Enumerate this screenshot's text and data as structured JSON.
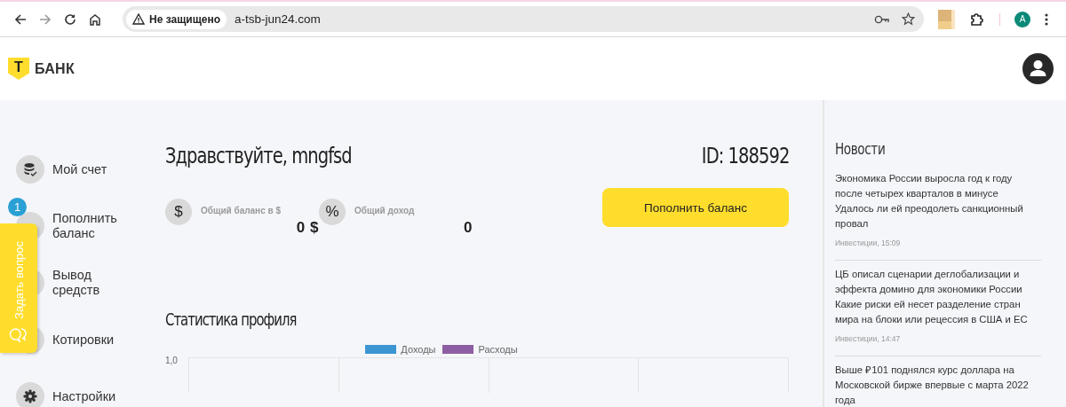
{
  "browser": {
    "security_label": "Не защищено",
    "url": "a-tsb-jun24.com",
    "profile_initial": "A"
  },
  "logo": {
    "mark": "Т",
    "name": "БАНК"
  },
  "nav": [
    {
      "label": "Мой счет",
      "kind": "coins"
    },
    {
      "label": "Пополнить баланс",
      "kind": "plain",
      "badge": "1"
    },
    {
      "label": "Вывод средств",
      "kind": "plain"
    },
    {
      "label": "Котировки",
      "kind": "plain"
    },
    {
      "label": "Настройки",
      "kind": "gear"
    }
  ],
  "ask_tab": {
    "label": "Задать вопрос"
  },
  "greeting": "Здравствуйте, mngfsd",
  "user_id": "ID: 188592",
  "stats": [
    {
      "symbol": "$",
      "label": "Общий баланс в $",
      "value": "0 $"
    },
    {
      "symbol": "%",
      "label": "Общий доход",
      "value": "0"
    }
  ],
  "topup_button": "Пополнить баланс",
  "chart": {
    "title": "Статистика профиля",
    "legend": [
      {
        "label": "Доходы",
        "color": "#3d95d1"
      },
      {
        "label": "Расходы",
        "color": "#8e5ea2"
      }
    ],
    "y_tick": "1,0"
  },
  "news": {
    "title": "Новости",
    "items": [
      {
        "title": "Экономика России выросла год к году после четырех кварталов в минусе",
        "subtitle": "Удалось ли ей преодолеть санкционный провал",
        "source": "Инвестиции, 15:09"
      },
      {
        "title": "ЦБ описал сценарии деглобализации и эффекта домино для экономики России",
        "subtitle": "Какие риски ей несет разделение стран мира на блоки или рецессия в США и ЕС",
        "source": "Инвестиции, 14:47"
      },
      {
        "title": "Выше ₽101 поднялся курс доллара на Московской бирже впервые с марта 2022 года"
      }
    ]
  }
}
